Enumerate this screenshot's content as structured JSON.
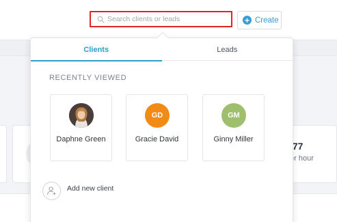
{
  "search": {
    "placeholder": "Search clients or leads"
  },
  "toolbar": {
    "create_label": "Create"
  },
  "dropdown": {
    "tabs": [
      {
        "label": "Clients",
        "active": true
      },
      {
        "label": "Leads",
        "active": false
      }
    ],
    "section_heading": "RECENTLY VIEWED",
    "clients": [
      {
        "name": "Daphne Green",
        "initials": "",
        "avatar": "photo"
      },
      {
        "name": "Gracie David",
        "initials": "GD",
        "avatar_color": "#f28a16"
      },
      {
        "name": "Ginny Miller",
        "initials": "GM",
        "avatar_color": "#9fbe6e"
      }
    ],
    "add_client_label": "Add new client"
  },
  "background": {
    "stat_value": ".77",
    "stat_label": "er hour"
  },
  "colors": {
    "accent": "#2e9fc7",
    "highlight_border": "#e02424",
    "create": "#3a9bd5"
  }
}
